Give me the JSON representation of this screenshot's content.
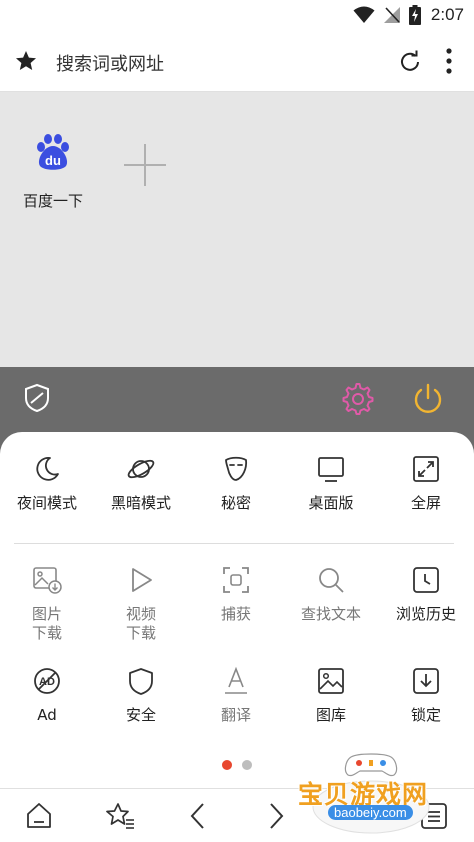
{
  "status_bar": {
    "time": "2:07",
    "icons": [
      "wifi-icon",
      "no-signal-icon",
      "battery-charging-icon"
    ]
  },
  "url_bar": {
    "placeholder": "搜索词或网址",
    "icons": [
      "star-icon",
      "reload-icon",
      "more-vert-icon"
    ]
  },
  "speed_dial": {
    "tiles": [
      {
        "label": "百度一下",
        "icon": "baidu-logo-icon",
        "logo_text": "du",
        "color": "#3b4ee0"
      }
    ],
    "add_icon": "add-icon"
  },
  "toolbar": {
    "icons": [
      "shield-icon",
      "gear-icon",
      "power-icon"
    ],
    "colors": {
      "gear": "#e05aa8",
      "power": "#f2b531",
      "background": "#6b6b6b"
    }
  },
  "menu": {
    "row1": [
      {
        "label": "夜间模式",
        "icon": "moon-icon"
      },
      {
        "label": "黑暗模式",
        "icon": "planet-icon"
      },
      {
        "label": "秘密",
        "icon": "mask-icon"
      },
      {
        "label": "桌面版",
        "icon": "monitor-icon"
      },
      {
        "label": "全屏",
        "icon": "fullscreen-icon"
      }
    ],
    "row2": [
      {
        "label_line1": "图片",
        "label_line2": "下载",
        "icon": "image-download-icon"
      },
      {
        "label_line1": "视频",
        "label_line2": "下载",
        "icon": "play-icon"
      },
      {
        "label": "捕获",
        "icon": "capture-icon"
      },
      {
        "label": "查找文本",
        "icon": "search-icon"
      },
      {
        "label": "浏览历史",
        "icon": "history-icon"
      }
    ],
    "row3": [
      {
        "label": "Ad",
        "icon": "ad-block-icon"
      },
      {
        "label": "安全",
        "icon": "shield-outline-icon"
      },
      {
        "label": "翻译",
        "icon": "translate-icon"
      },
      {
        "label": "图库",
        "icon": "gallery-icon"
      },
      {
        "label": "锁定",
        "icon": "lock-download-icon"
      }
    ],
    "page_indicator": {
      "count": 2,
      "active": 1,
      "active_color": "#e8472f",
      "inactive_color": "#bdbdbd"
    }
  },
  "bottom_nav": {
    "icons": [
      "home-icon",
      "bookmark-star-icon",
      "back-icon",
      "forward-icon",
      "tabs-icon",
      "menu-icon"
    ]
  },
  "watermark": {
    "text": "宝贝游戏网",
    "url": "baobeiy.com"
  }
}
